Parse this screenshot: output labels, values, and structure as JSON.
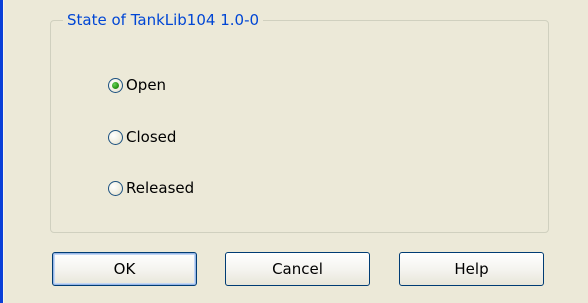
{
  "group": {
    "title": "State of TankLib104 1.0-0"
  },
  "state_options": [
    {
      "label": "Open",
      "selected": true
    },
    {
      "label": "Closed",
      "selected": false
    },
    {
      "label": "Released",
      "selected": false
    }
  ],
  "buttons": {
    "ok_label": "OK",
    "cancel_label": "Cancel",
    "help_label": "Help"
  },
  "colors": {
    "window_border": "#0a3fd8",
    "dialog_background": "#ece9d8",
    "group_title": "#0046d5",
    "group_border": "#d0d0bf",
    "button_border": "#003c74",
    "radio_selected": "#2f9b1a"
  }
}
